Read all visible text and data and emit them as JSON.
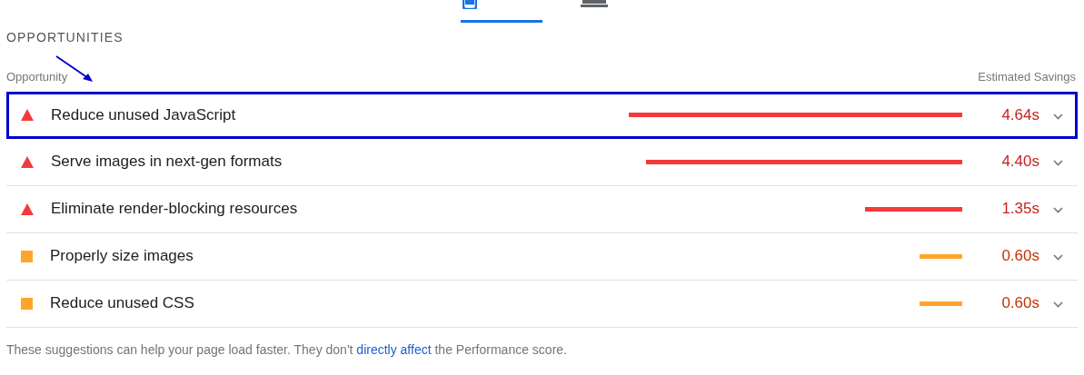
{
  "tabs": [
    {
      "kind": "mobile",
      "selected": true
    },
    {
      "kind": "desktop",
      "selected": false
    }
  ],
  "section_title": "OPPORTUNITIES",
  "table": {
    "columns": [
      "Opportunity",
      "Estimated Savings"
    ],
    "rows": [
      {
        "kind": "fail",
        "title": "Reduce unused JavaScript",
        "savings": "4.64s",
        "highlighted": true
      },
      {
        "kind": "fail",
        "title": "Serve images in next-gen formats",
        "savings": "4.40s",
        "highlighted": false
      },
      {
        "kind": "fail",
        "title": "Eliminate render-blocking resources",
        "savings": "1.35s",
        "highlighted": false
      },
      {
        "kind": "average",
        "title": "Properly size images",
        "savings": "0.60s",
        "highlighted": false
      },
      {
        "kind": "average",
        "title": "Reduce unused CSS",
        "savings": "0.60s",
        "highlighted": false
      }
    ]
  },
  "footer": {
    "before": "These suggestions can help your page load faster. They don't ",
    "link": "directly affect",
    "after": " the Performance score."
  }
}
